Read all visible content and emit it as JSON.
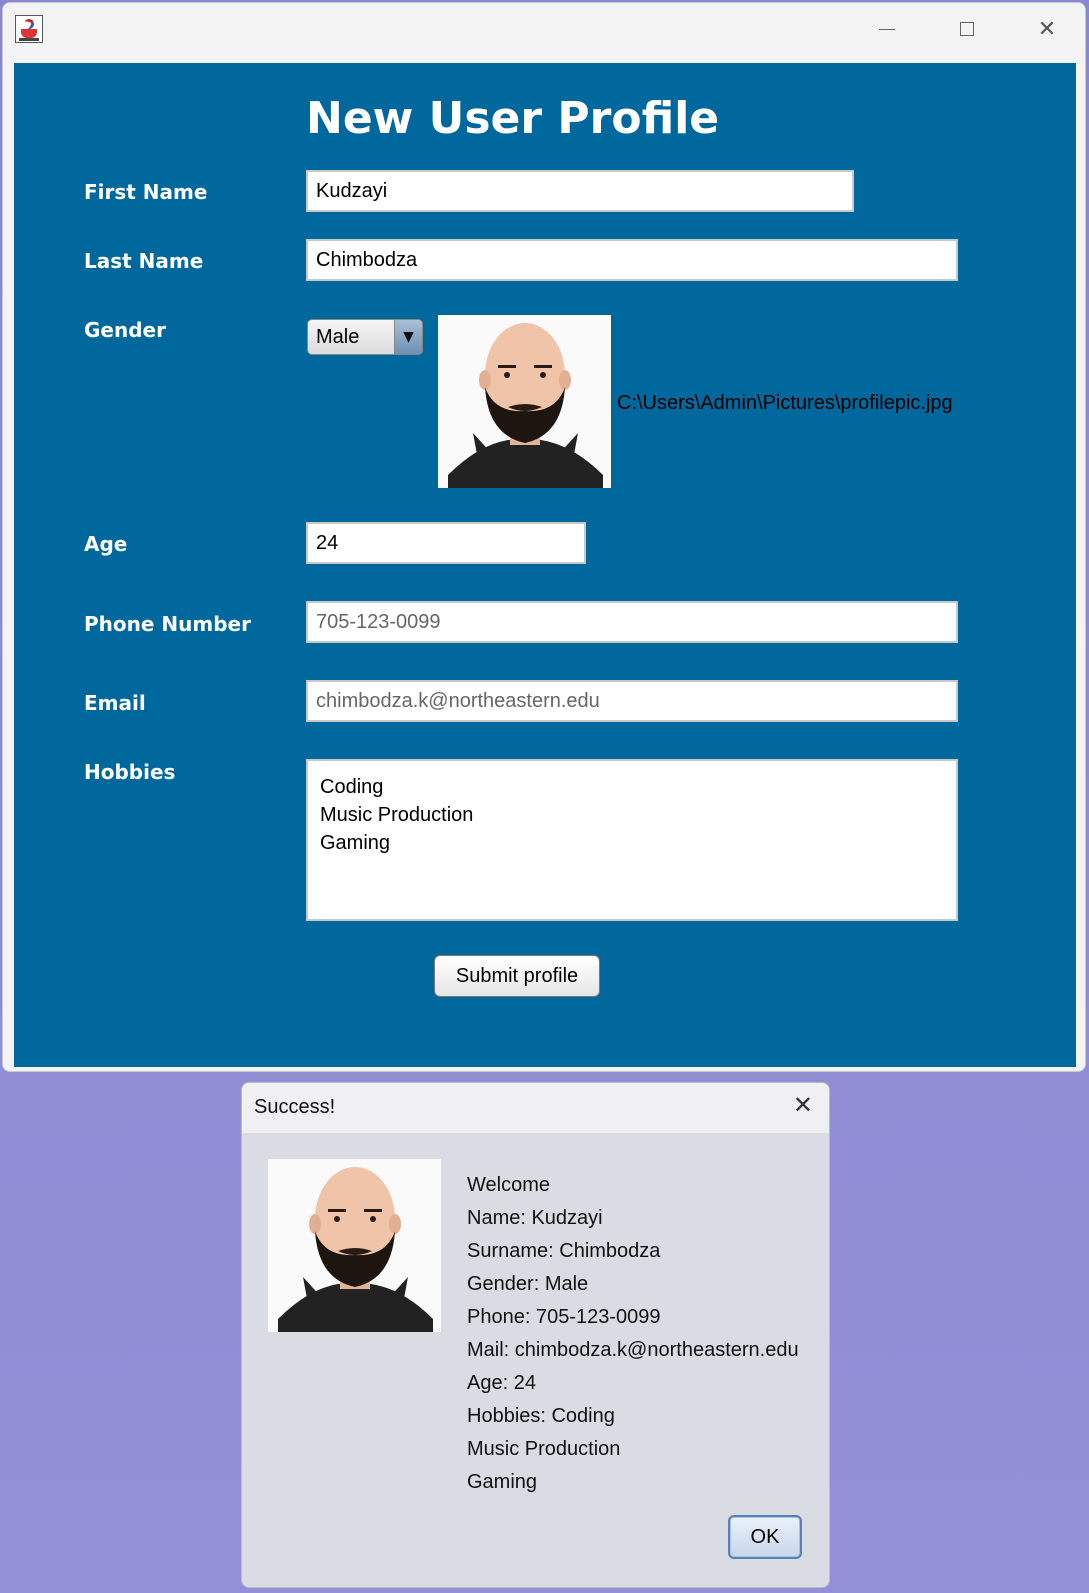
{
  "form": {
    "title": "New User Profile",
    "labels": {
      "first_name": "First Name",
      "last_name": "Last Name",
      "gender": "Gender",
      "age": "Age",
      "phone": "Phone Number",
      "email": "Email",
      "hobbies": "Hobbies"
    },
    "values": {
      "first_name": "Kudzayi",
      "last_name": "Chimbodza",
      "gender": "Male",
      "age": "24",
      "phone": "705-123-0099",
      "email": "chimbodza.k@northeastern.edu",
      "hobbies": [
        "Coding",
        "Music Production",
        "Gaming"
      ]
    },
    "profile_image_path": "C:\\Users\\Admin\\Pictures\\profilepic.jpg",
    "submit_label": "Submit profile"
  },
  "dialog": {
    "title": "Success!",
    "lines": [
      "Welcome",
      "Name: Kudzayi",
      "Surname: Chimbodza",
      "Gender: Male",
      "Phone: 705-123-0099",
      "Mail: chimbodza.k@northeastern.edu",
      "Age: 24",
      "Hobbies: Coding",
      "Music Production",
      "Gaming"
    ],
    "ok_label": "OK"
  },
  "colors": {
    "form_background": "#01689d",
    "desktop_background": "#8a86cf"
  },
  "icons": {
    "window_minimize": "minimize-icon",
    "window_maximize": "maximize-icon",
    "window_close": "close-icon",
    "app": "java-icon"
  }
}
